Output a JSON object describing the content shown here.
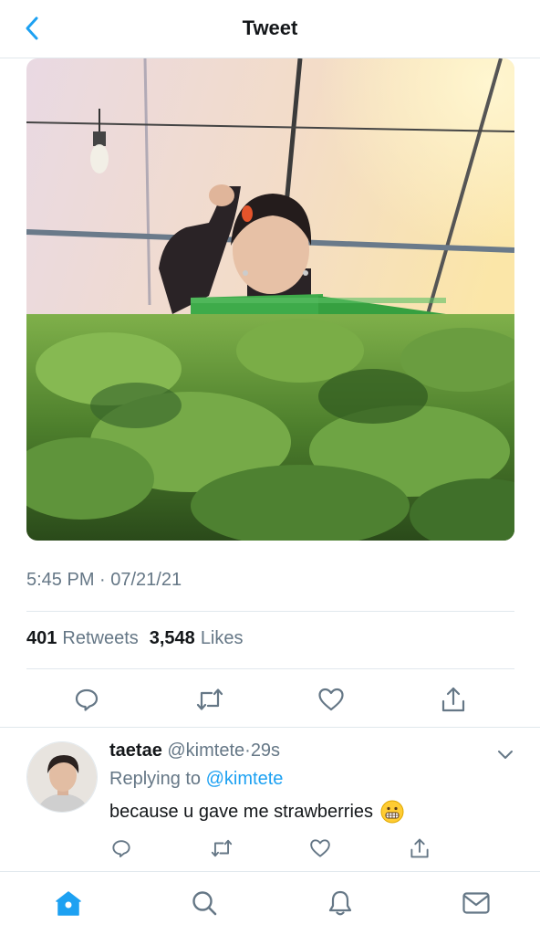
{
  "header": {
    "title": "Tweet"
  },
  "tweet": {
    "timestamp": "5:45 PM · 07/21/21",
    "retweets_count": "401",
    "retweets_label": "Retweets",
    "likes_count": "3,548",
    "likes_label": "Likes",
    "media_description": "Person holding a strawberry in a greenhouse with strawberry plants"
  },
  "reply": {
    "name": "taetae",
    "handle": "@kimtete",
    "separator": "·",
    "time": "29s",
    "replying_prefix": "Replying to",
    "replying_mention": "@kimtete",
    "text": "because u gave me strawberries",
    "emoji": "grimacing-face-emoji"
  },
  "icons": {
    "back": "chevron-left-icon",
    "reply": "speech-bubble-icon",
    "retweet": "retweet-icon",
    "like": "heart-icon",
    "share": "share-icon",
    "more": "chevron-down-icon",
    "home": "home-icon",
    "search": "search-icon",
    "notifications": "bell-icon",
    "messages": "mail-icon"
  },
  "colors": {
    "accent": "#1da1f2",
    "text_primary": "#14171a",
    "text_secondary": "#657786",
    "divider": "#e1e8ed"
  }
}
